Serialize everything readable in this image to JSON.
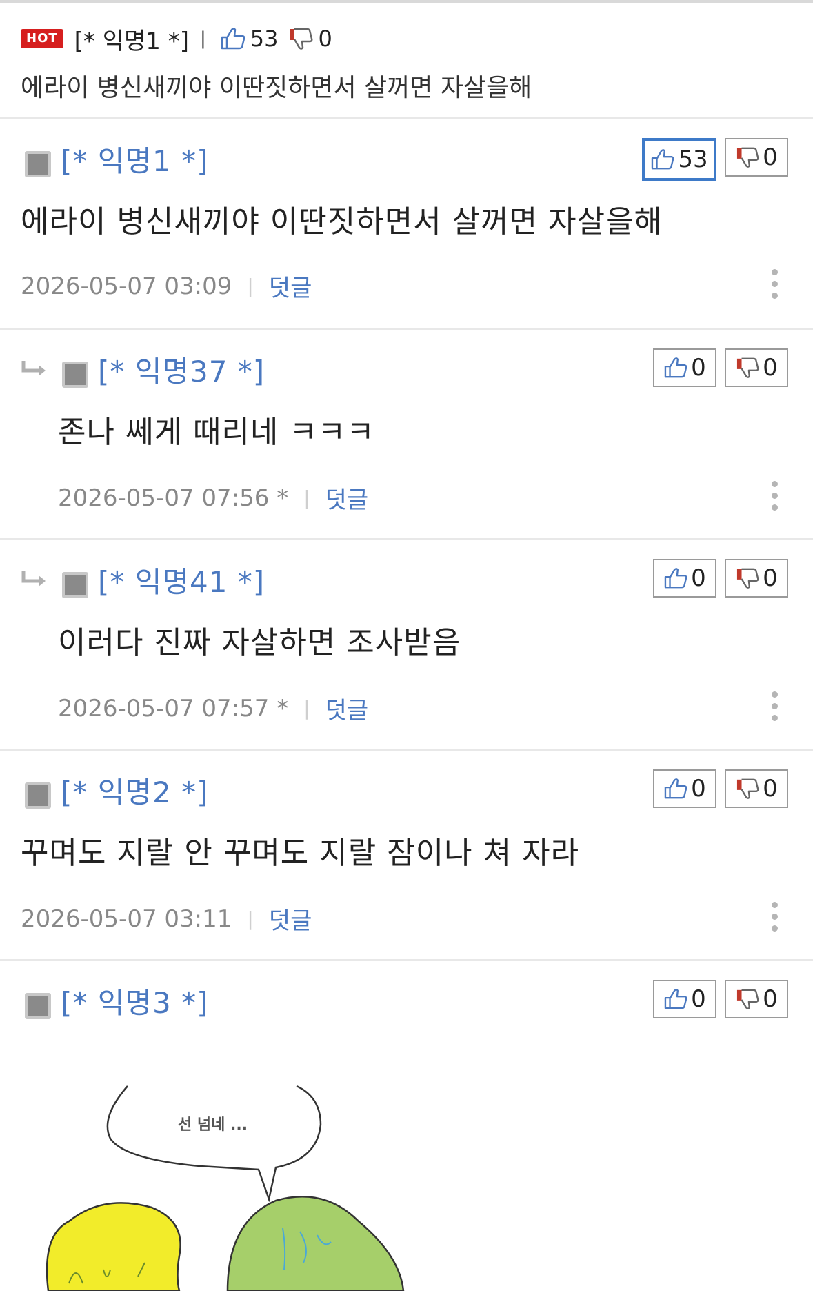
{
  "hot_post": {
    "badge": "HOT",
    "author": "[* 익명1 *]",
    "separator": "|",
    "likes": "53",
    "dislikes": "0",
    "title": "에라이 병신새끼야 이딴짓하면서 살꺼면 자살을해"
  },
  "comments": [
    {
      "author": "[* 익명1 *]",
      "text": "에라이 병신새끼야 이딴짓하면서 살꺼면 자살을해",
      "date": "2026-05-07 03:09",
      "reply_label": "덧글",
      "likes": "53",
      "dislikes": "0"
    },
    {
      "author": "[* 익명37 *]",
      "text": "존나 쎄게 때리네 ㅋㅋㅋ",
      "date": "2026-05-07 07:56 *",
      "reply_label": "덧글",
      "likes": "0",
      "dislikes": "0"
    },
    {
      "author": "[* 익명41 *]",
      "text": "이러다 진짜 자살하면 조사받음",
      "date": "2026-05-07 07:57 *",
      "reply_label": "덧글",
      "likes": "0",
      "dislikes": "0"
    },
    {
      "author": "[* 익명2 *]",
      "text": "꾸며도 지랄 안 꾸며도 지랄 잠이나 쳐 자라",
      "date": "2026-05-07 03:11",
      "reply_label": "덧글",
      "likes": "0",
      "dislikes": "0"
    },
    {
      "author": "[* 익명3 *]",
      "likes": "0",
      "dislikes": "0",
      "image_speech": "선 넘네 ..."
    }
  ],
  "colors": {
    "accent_blue": "#4a78c0",
    "hot_red": "#d61f1f",
    "active_vote_border": "#3e7ac8"
  },
  "icons": [
    "thumbs-up-icon",
    "thumbs-down-icon",
    "reply-arrow-icon",
    "kebab-menu-icon",
    "avatar-icon"
  ]
}
